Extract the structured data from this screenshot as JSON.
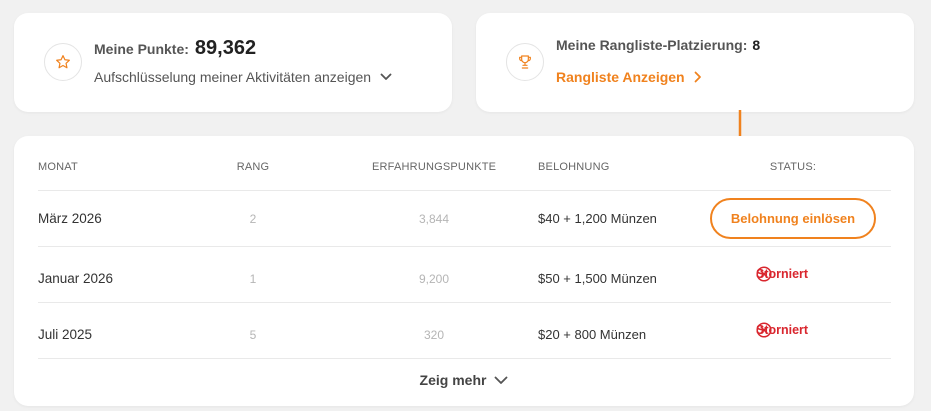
{
  "points_card": {
    "label": "Meine Punkte:",
    "value": "89,362",
    "link": "Aufschlüsselung meiner Aktivitäten anzeigen",
    "icon": "star-icon"
  },
  "rank_card": {
    "label": "Meine Rangliste-Platzierung:",
    "value": "8",
    "link": "Rangliste Anzeigen",
    "icon": "trophy-icon"
  },
  "table": {
    "headers": {
      "month": "MONAT",
      "rank": "RANG",
      "xp": "ERFAHRUNGSPUNKTE",
      "reward": "BELOHNUNG",
      "status": "STATUS:"
    },
    "rows": [
      {
        "month": "März 2026",
        "rank": "2",
        "xp": "3,844",
        "reward": "$40 + 1,200 Münzen",
        "status": "Belohnung einlösen",
        "status_type": "redeem"
      },
      {
        "month": "Januar 2026",
        "rank": "1",
        "xp": "9,200",
        "reward": "$50 + 1,500 Münzen",
        "status": "Storniert",
        "status_type": "cancelled"
      },
      {
        "month": "Juli 2025",
        "rank": "5",
        "xp": "320",
        "reward": "$20 + 800 Münzen",
        "status": "Storniert",
        "status_type": "cancelled"
      }
    ],
    "show_more": "Zeig mehr"
  },
  "colors": {
    "accent": "#f0821e",
    "danger": "#d9262e",
    "background": "#f1f1f1"
  }
}
